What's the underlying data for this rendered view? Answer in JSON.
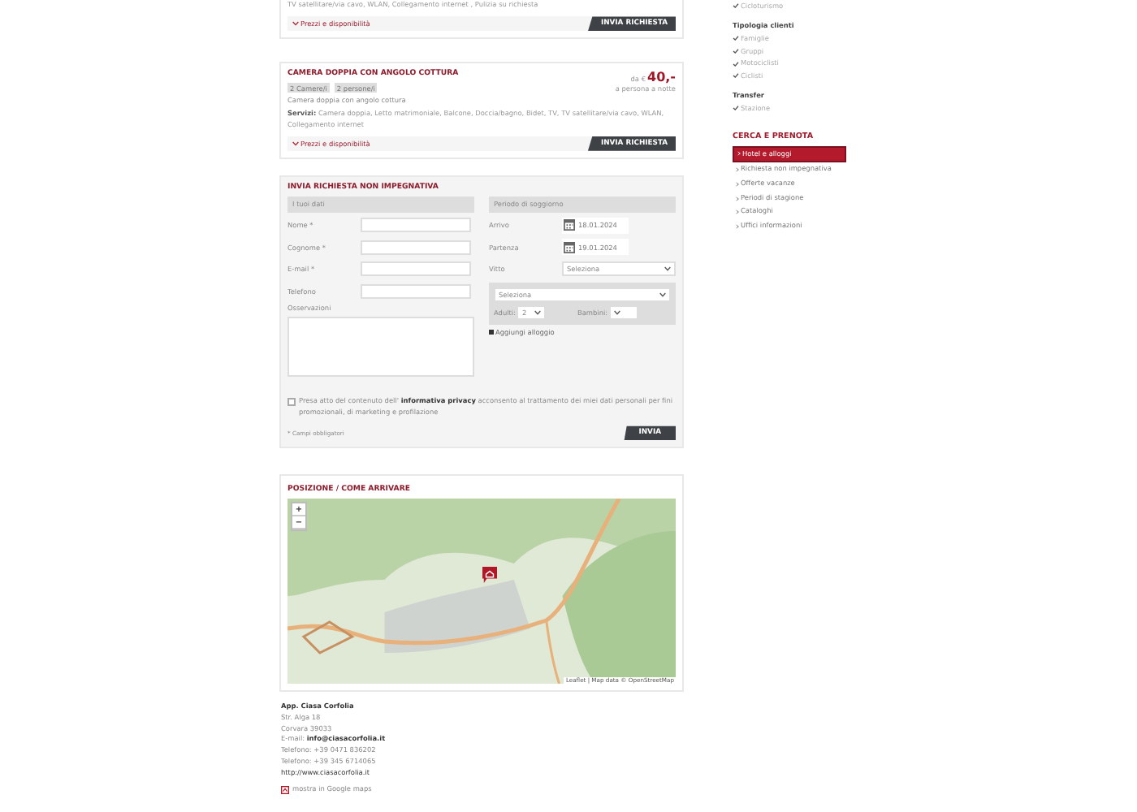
{
  "rooms": [
    {
      "services": "TV satellitare/via cavo, WLAN, Collegamento internet , Pulizia su richiesta",
      "link": "Prezzi e disponibilità",
      "button": "INVIA RICHIESTA"
    },
    {
      "title": "CAMERA DOPPIA CON ANGOLO COTTURA",
      "tags": [
        "2 Camere/i",
        "2 persone/i"
      ],
      "price_prefix": "da €",
      "price": "40,-",
      "price_note": "a persona a notte",
      "description": "Camera doppia con angolo cottura",
      "services_label": "Servizi:",
      "services": "Camera doppia, Letto matrimoniale, Balcone, Doccia/bagno, Bidet, TV, TV satellitare/via cavo, WLAN, Collegamento internet",
      "link": "Prezzi e disponibilità",
      "button": "INVIA RICHIESTA"
    }
  ],
  "inquiry": {
    "title": "INVIA RICHIESTA NON IMPEGNATIVA",
    "personal_heading": "I tuoi dati",
    "fields": [
      {
        "label": "Nome *"
      },
      {
        "label": "Cognome *"
      },
      {
        "label": "E-mail *"
      },
      {
        "label": "Telefono"
      }
    ],
    "notes_label": "Osservazioni",
    "stay_heading": "Periodo di soggiorno",
    "dates": [
      {
        "label": "Arrivo",
        "value": "18.01.2024"
      },
      {
        "label": "Partenza",
        "value": "19.01.2024"
      }
    ],
    "board": {
      "label": "Vitto",
      "value": "Seleziona"
    },
    "room_select": "Seleziona",
    "adults": {
      "label": "Adulti:",
      "value": "2"
    },
    "children": {
      "label": "Bambini:"
    },
    "add_room": "Aggiungi alloggio",
    "privacy": {
      "checked": false,
      "text": "Presa atto del contenuto dell' **informativa privacy** acconsento al trattamento dei miei dati personali per fini promozionali, di marketing e profilazione"
    },
    "required_note": "* Campi obbligatori",
    "submit": "INVIA"
  },
  "location": {
    "title": "POSIZIONE / COME ARRIVARE",
    "zoom_in": "+",
    "zoom_out": "−",
    "attribution": "Leaflet | Map data © OpenStreetMap",
    "name": "App. Ciasa Corfolia",
    "lines": [
      "Str. Alga 18",
      "Corvara 39033",
      "E-mail: **info@ciasacorfolia.it**",
      "Telefono: +39 0471 836202",
      "Telefono: +39 345 6714065"
    ],
    "url": "http://www.ciasacorfolia.it",
    "maps_link": "mostra in Google maps"
  },
  "sidebar": {
    "groups": [
      {
        "items": [
          {
            "label": "Cicloturismo",
            "checked": true
          }
        ]
      },
      {
        "heading": "Tipologia clienti",
        "items": [
          {
            "label": "Famiglie",
            "checked": true
          },
          {
            "label": "Gruppi",
            "checked": true
          },
          {
            "label": "Motociclisti",
            "checked": true
          },
          {
            "label": "Ciclisti",
            "checked": true
          }
        ]
      },
      {
        "heading": "Transfer",
        "items": [
          {
            "label": "Stazione",
            "checked": true
          }
        ]
      }
    ],
    "search_title": "CERCA E PRENOTA",
    "links": [
      {
        "label": "Hotel e alloggi",
        "selected": true
      },
      {
        "label": "Richiesta non impegnativa",
        "selected": false
      },
      {
        "label": "Offerte vacanze",
        "selected": false
      },
      {
        "label": "Periodi di stagione",
        "selected": false
      },
      {
        "label": "Cataloghi",
        "selected": false
      },
      {
        "label": "Uffici informazioni",
        "selected": false
      }
    ]
  }
}
